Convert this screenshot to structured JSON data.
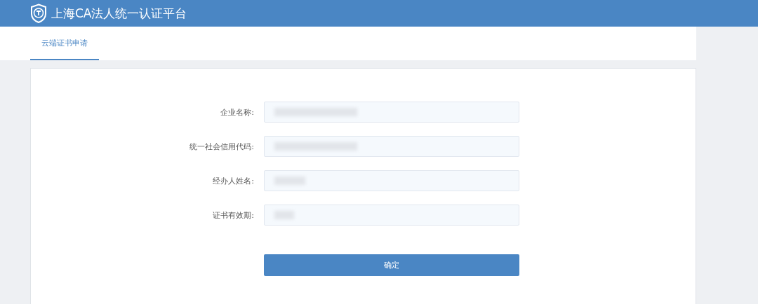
{
  "header": {
    "title": "上海CA法人统一认证平台"
  },
  "tabs": [
    {
      "label": "云端证书申请",
      "selected": true
    }
  ],
  "form": {
    "fields": [
      {
        "label": "企业名称:",
        "redacted": true
      },
      {
        "label": "统一社会信用代码:",
        "redacted": true
      },
      {
        "label": "经办人姓名:",
        "redacted": true
      },
      {
        "label": "证书有效期:",
        "redacted": true
      }
    ],
    "submit": "确定"
  }
}
